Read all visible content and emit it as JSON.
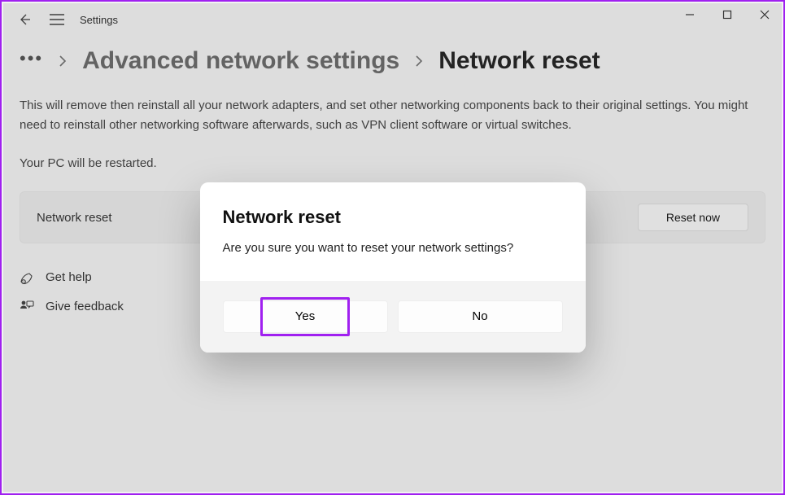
{
  "app": {
    "title": "Settings"
  },
  "breadcrumb": {
    "parent": "Advanced network settings",
    "current": "Network reset"
  },
  "main": {
    "description": "This will remove then reinstall all your network adapters, and set other networking components back to their original settings. You might need to reinstall other networking software afterwards, such as VPN client software or virtual switches.",
    "restart_note": "Your PC will be restarted.",
    "card_label": "Network reset",
    "reset_button": "Reset now"
  },
  "links": {
    "get_help": "Get help",
    "give_feedback": "Give feedback"
  },
  "dialog": {
    "title": "Network reset",
    "message": "Are you sure you want to reset your network settings?",
    "yes": "Yes",
    "no": "No"
  }
}
